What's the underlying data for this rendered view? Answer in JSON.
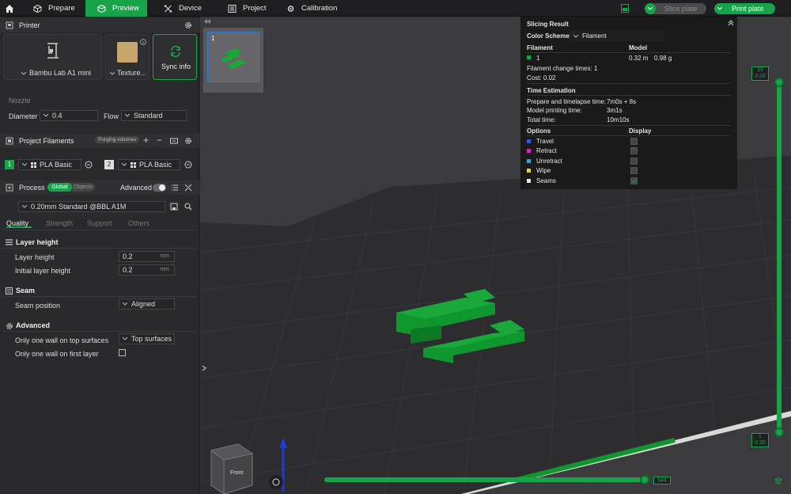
{
  "tabs": [
    {
      "label": "Prepare"
    },
    {
      "label": "Preview"
    },
    {
      "label": "Device"
    },
    {
      "label": "Project"
    },
    {
      "label": "Calibration"
    }
  ],
  "toolbar": {
    "slice_label": "Slice plate",
    "print_label": "Print plate"
  },
  "printer": {
    "section_title": "Printer",
    "model": "Bambu Lab A1 mini",
    "plate": "Texture...",
    "sync": "Sync info"
  },
  "nozzle": {
    "title": "Nozzle",
    "diameter_label": "Diameter",
    "diameter_value": "0.4",
    "flow_label": "Flow",
    "flow_value": "Standard"
  },
  "filaments": {
    "title": "Project Filaments",
    "purging": "Purging volumes",
    "items": [
      {
        "index": "1",
        "name": "PLA Basic"
      },
      {
        "index": "2",
        "name": "PLA Basic"
      }
    ]
  },
  "process": {
    "title": "Process",
    "global": "Global",
    "objects": "Objects",
    "advanced": "Advanced",
    "preset": "0.20mm Standard @BBL A1M",
    "tabs": [
      "Quality",
      "Strength",
      "Support",
      "Others"
    ]
  },
  "quality": {
    "layer_height_title": "Layer height",
    "layer_height_label": "Layer height",
    "layer_height_value": "0.2",
    "initial_layer_label": "Initial layer height",
    "initial_layer_value": "0.2",
    "unit": "mm",
    "seam_title": "Seam",
    "seam_position_label": "Seam position",
    "seam_position_value": "Aligned",
    "advanced_title": "Advanced",
    "one_wall_top_label": "Only one wall on top surfaces",
    "one_wall_top_value": "Top surfaces",
    "one_wall_first_label": "Only one wall on first layer"
  },
  "slicing_result": {
    "title": "Slicing Result",
    "color_scheme_label": "Color Scheme",
    "color_scheme_value": "Filament",
    "filament_head": "Filament",
    "model_head": "Model",
    "filament_index": "1",
    "length": "0.32 m",
    "weight": "0.98 g",
    "change_times": "Filament change times:  1",
    "cost": "Cost:  0.02",
    "time_title": "Time Estimation",
    "prepare_label": "Prepare and timelapse time:",
    "prepare_value": "7m0s + 8s",
    "model_time_label": "Model printing time:",
    "model_time_value": "3m1s",
    "total_label": "Total time:",
    "total_value": "10m10s",
    "options_head": "Options",
    "display_head": "Display",
    "options": [
      {
        "label": "Travel",
        "color": "#2b5fd9"
      },
      {
        "label": "Retract",
        "color": "#c32bc3"
      },
      {
        "label": "Unretract",
        "color": "#2ba6e6"
      },
      {
        "label": "Wipe",
        "color": "#e6d22b"
      },
      {
        "label": "Seams",
        "color": "#e6e6e6"
      }
    ]
  },
  "plate_thumb": {
    "number": "1"
  },
  "layer_slider": {
    "top_index": "16",
    "top_height": "3.20",
    "bottom_index": "1",
    "bottom_height": "0.20"
  },
  "move_slider": {
    "value": "548"
  },
  "view_cube": {
    "face": "Front"
  },
  "colors": {
    "accent": "#16a34a",
    "model_green": "#10962e"
  }
}
